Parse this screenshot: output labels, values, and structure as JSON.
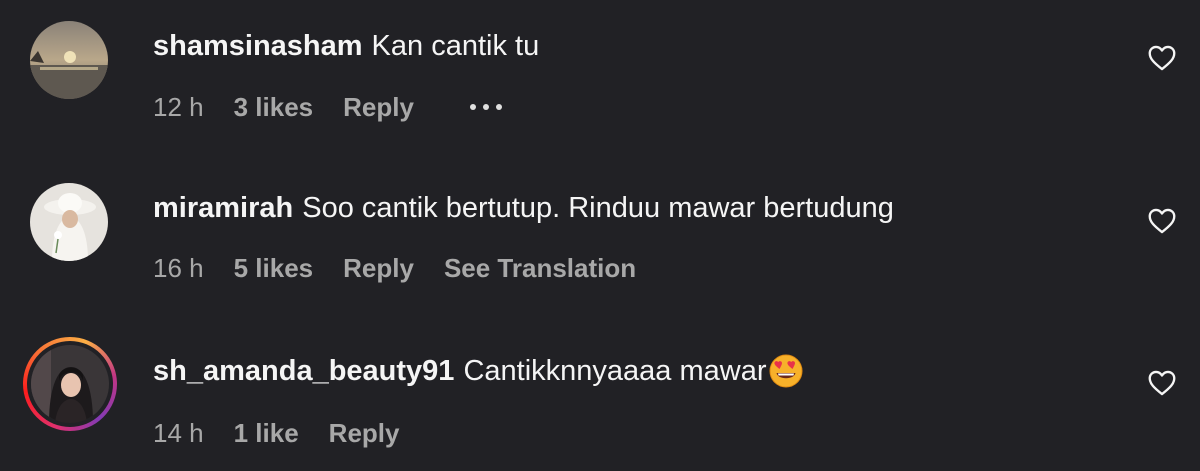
{
  "comments": [
    {
      "username": "shamsinasham",
      "text": "Kan cantik tu",
      "time": "12 h",
      "likes": "3 likes",
      "reply": "Reply",
      "extra": ""
    },
    {
      "username": "miramirah",
      "text": "Soo cantik bertutup. Rinduu mawar bertudung",
      "time": "16 h",
      "likes": "5 likes",
      "reply": "Reply",
      "extra": "See Translation"
    },
    {
      "username": "sh_amanda_beauty91",
      "text": "Cantikknnyaaaa mawar",
      "time": "14 h",
      "likes": "1 like",
      "reply": "Reply",
      "extra": ""
    }
  ],
  "icons": {
    "like": "heart-outline-icon",
    "more": "more-options-icon",
    "emoji": "heart-eyes-emoji"
  },
  "colors": {
    "background": "#212125",
    "primary_text": "#f5f5f5",
    "secondary_text": "#a8a8a8"
  }
}
